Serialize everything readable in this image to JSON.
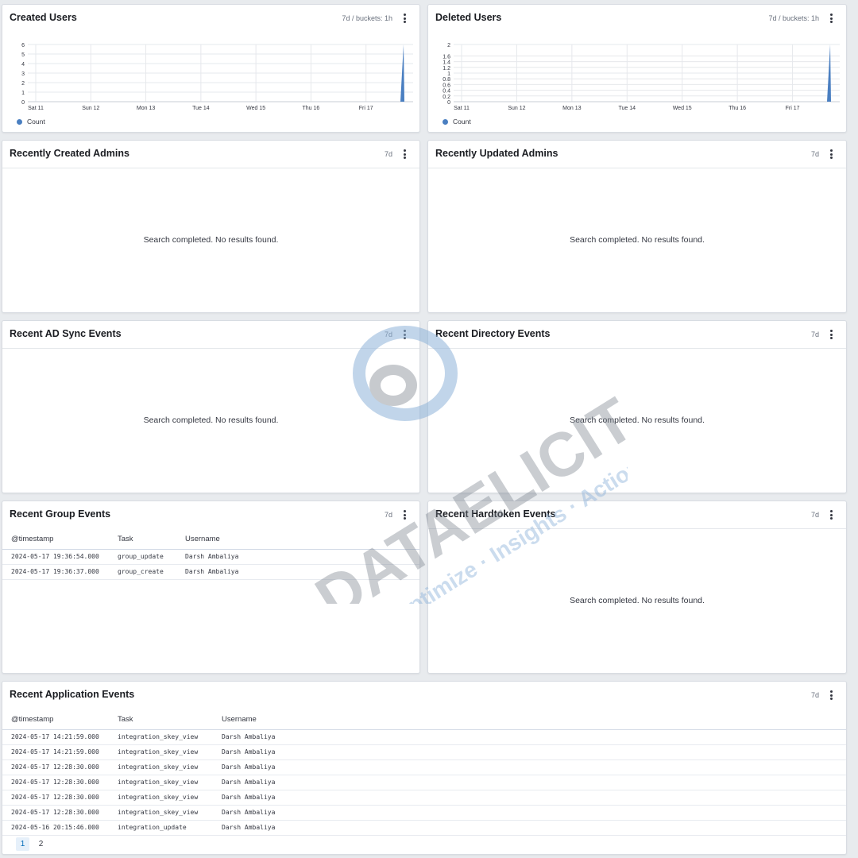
{
  "panels": {
    "created_users": {
      "title": "Created Users",
      "meta": "7d / buckets: 1h",
      "legend": "Count"
    },
    "deleted_users": {
      "title": "Deleted Users",
      "meta": "7d / buckets: 1h",
      "legend": "Count"
    },
    "recent_created_admins": {
      "title": "Recently Created Admins",
      "meta": "7d",
      "empty": "Search completed. No results found."
    },
    "recent_updated_admins": {
      "title": "Recently Updated Admins",
      "meta": "7d",
      "empty": "Search completed. No results found."
    },
    "recent_ad_sync": {
      "title": "Recent AD Sync Events",
      "meta": "7d",
      "empty": "Search completed. No results found."
    },
    "recent_directory": {
      "title": "Recent Directory Events",
      "meta": "7d",
      "empty": "Search completed. No results found."
    },
    "recent_group": {
      "title": "Recent Group Events",
      "meta": "7d",
      "columns": [
        "@timestamp",
        "Task",
        "Username"
      ],
      "rows": [
        [
          "2024-05-17 19:36:54.000",
          "group_update",
          "Darsh Ambaliya"
        ],
        [
          "2024-05-17 19:36:37.000",
          "group_create",
          "Darsh Ambaliya"
        ]
      ]
    },
    "recent_hardtoken": {
      "title": "Recent Hardtoken Events",
      "meta": "7d",
      "empty": "Search completed. No results found."
    },
    "recent_application": {
      "title": "Recent Application Events",
      "meta": "7d",
      "columns": [
        "@timestamp",
        "Task",
        "Username"
      ],
      "rows": [
        [
          "2024-05-17 14:21:59.000",
          "integration_skey_view",
          "Darsh Ambaliya"
        ],
        [
          "2024-05-17 14:21:59.000",
          "integration_skey_view",
          "Darsh Ambaliya"
        ],
        [
          "2024-05-17 12:28:30.000",
          "integration_skey_view",
          "Darsh Ambaliya"
        ],
        [
          "2024-05-17 12:28:30.000",
          "integration_skey_view",
          "Darsh Ambaliya"
        ],
        [
          "2024-05-17 12:28:30.000",
          "integration_skey_view",
          "Darsh Ambaliya"
        ],
        [
          "2024-05-17 12:28:30.000",
          "integration_skey_view",
          "Darsh Ambaliya"
        ],
        [
          "2024-05-16 20:15:46.000",
          "integration_update",
          "Darsh Ambaliya"
        ]
      ],
      "pages": [
        "1",
        "2"
      ],
      "active_page": "1"
    }
  },
  "watermark": {
    "brand": "DATAELICIT",
    "tagline": "Optimize · Insights · Action"
  },
  "colors": {
    "series": "#4a7fc1",
    "grid": "#e6e8ec"
  },
  "chart_data": [
    {
      "type": "area",
      "title": "Created Users",
      "categories": [
        "Sat 11",
        "Sun 12",
        "Mon 13",
        "Tue 14",
        "Wed 15",
        "Thu 16",
        "Fri 17"
      ],
      "yticks": [
        "0",
        "1",
        "2",
        "3",
        "4",
        "5",
        "6"
      ],
      "ylim": [
        0,
        6
      ],
      "series": [
        {
          "name": "Count",
          "spike_at": "Fri 17 end",
          "values": [
            0,
            0,
            0,
            0,
            0,
            0,
            6
          ]
        }
      ],
      "legend": "bottom-left",
      "grid": true
    },
    {
      "type": "area",
      "title": "Deleted Users",
      "categories": [
        "Sat 11",
        "Sun 12",
        "Mon 13",
        "Tue 14",
        "Wed 15",
        "Thu 16",
        "Fri 17"
      ],
      "yticks": [
        "0",
        "0.2",
        "0.4",
        "0.6",
        "0.8",
        "1",
        "1.2",
        "1.4",
        "1.6",
        "2"
      ],
      "ylim": [
        0,
        2
      ],
      "series": [
        {
          "name": "Count",
          "spike_at": "Fri 17 end",
          "values": [
            0,
            0,
            0,
            0,
            0,
            0,
            2
          ]
        }
      ],
      "legend": "bottom-left",
      "grid": true
    }
  ]
}
